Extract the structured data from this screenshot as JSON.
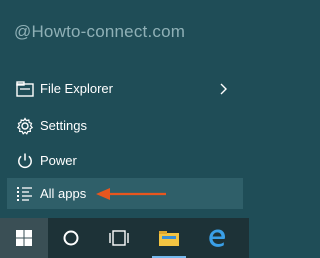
{
  "watermark": "@Howto-connect.com",
  "menu": {
    "file_explorer": {
      "label": "File Explorer",
      "icon": "file-explorer-icon",
      "has_submenu": true
    },
    "settings": {
      "label": "Settings",
      "icon": "gear-icon"
    },
    "power": {
      "label": "Power",
      "icon": "power-icon"
    },
    "all_apps": {
      "label": "All apps",
      "icon": "list-icon",
      "highlighted": true
    }
  },
  "annotation": {
    "arrow_color": "#e8561e"
  },
  "taskbar": {
    "items": [
      {
        "name": "start",
        "icon": "windows-logo-icon"
      },
      {
        "name": "search",
        "icon": "cortana-circle-icon"
      },
      {
        "name": "task-view",
        "icon": "task-view-icon"
      },
      {
        "name": "file-explorer",
        "icon": "folder-icon",
        "active": true
      },
      {
        "name": "edge",
        "icon": "edge-icon"
      }
    ]
  },
  "colors": {
    "panel_bg": "#1f4d57",
    "highlight_bg": "#2f5f69",
    "taskbar_bg": "#1d3237",
    "accent": "#76b9ed"
  }
}
